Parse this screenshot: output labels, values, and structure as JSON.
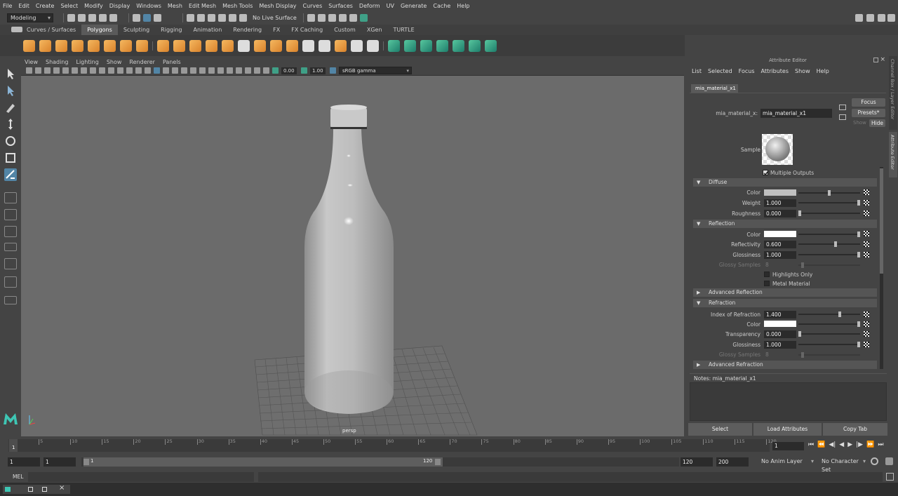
{
  "menubar": [
    "File",
    "Edit",
    "Create",
    "Select",
    "Modify",
    "Display",
    "Windows",
    "Mesh",
    "Edit Mesh",
    "Mesh Tools",
    "Mesh Display",
    "Curves",
    "Surfaces",
    "Deform",
    "UV",
    "Generate",
    "Cache",
    "Help"
  ],
  "statusline": {
    "mode": "Modeling",
    "live_surface": "No Live Surface"
  },
  "shelf_tabs": [
    "Curves / Surfaces",
    "Polygons",
    "Sculpting",
    "Rigging",
    "Animation",
    "Rendering",
    "FX",
    "FX Caching",
    "Custom",
    "XGen",
    "TURTLE"
  ],
  "shelf_active": "Polygons",
  "viewport": {
    "menu": [
      "View",
      "Shading",
      "Lighting",
      "Show",
      "Renderer",
      "Panels"
    ],
    "field1": "0.00",
    "field2": "1.00",
    "colorspace": "sRGB gamma",
    "camera": "persp"
  },
  "attribute_editor": {
    "title": "Attribute Editor",
    "menu": [
      "List",
      "Selected",
      "Focus",
      "Attributes",
      "Show",
      "Help"
    ],
    "tab": "mia_material_x1",
    "node_label": "mia_material_x:",
    "node_name": "mia_material_x1",
    "focus": "Focus",
    "presets": "Presets*",
    "show": "Show",
    "hide": "Hide",
    "sample": "Sample",
    "multiple_outputs": "Multiple Outputs",
    "diffuse": {
      "title": "Diffuse",
      "color": "Color",
      "weight": "Weight",
      "weight_val": "1.000",
      "roughness": "Roughness",
      "roughness_val": "0.000"
    },
    "reflection": {
      "title": "Reflection",
      "color": "Color",
      "reflectivity": "Reflectivity",
      "reflectivity_val": "0.600",
      "glossiness": "Glossiness",
      "glossiness_val": "1.000",
      "glossy_samples": "Glossy Samples",
      "glossy_samples_val": "8",
      "highlights_only": "Highlights Only",
      "metal_material": "Metal Material"
    },
    "advanced_reflection": "Advanced Reflection",
    "refraction": {
      "title": "Refraction",
      "ior": "Index of Refraction",
      "ior_val": "1.400",
      "color": "Color",
      "transparency": "Transparency",
      "transparency_val": "0.000",
      "glossiness": "Glossiness",
      "glossiness_val": "1.000",
      "glossy_samples": "Glossy Samples",
      "glossy_samples_val": "8"
    },
    "advanced_refraction": "Advanced Refraction",
    "notes": "Notes:  mia_material_x1",
    "buttons": [
      "Select",
      "Load Attributes",
      "Copy Tab"
    ],
    "side_tabs": [
      "Channel Box / Layer Editor",
      "Attribute Editor"
    ]
  },
  "timeline": {
    "ticks": [
      "5",
      "10",
      "15",
      "20",
      "25",
      "30",
      "35",
      "40",
      "45",
      "50",
      "55",
      "60",
      "65",
      "70",
      "75",
      "80",
      "85",
      "90",
      "95",
      "100",
      "105",
      "110",
      "115",
      "120"
    ],
    "start_tick": "1",
    "current_frame": "1"
  },
  "range": {
    "start": "1",
    "inner_start": "1",
    "slider_start": "1",
    "slider_end": "120",
    "end": "120",
    "max": "200",
    "anim_layer": "No Anim Layer",
    "char_set": "No Character Set"
  },
  "cmdline": {
    "label": "MEL"
  },
  "colors": {
    "bg": "#444444",
    "viewport": "#6b6b6b",
    "accent": "#5285a6"
  }
}
